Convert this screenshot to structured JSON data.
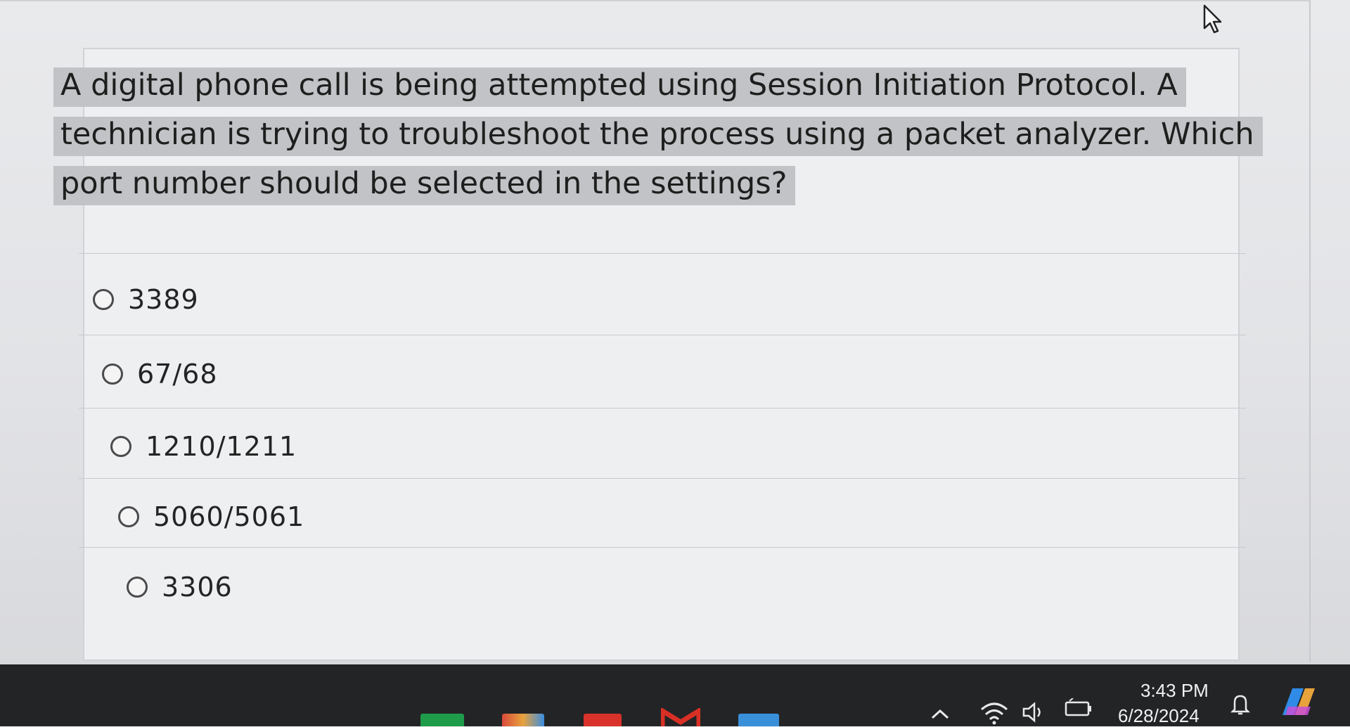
{
  "question": {
    "text": "A digital phone call is being attempted using Session Initiation Protocol. A technician is trying to troubleshoot the process using a packet analyzer. Which port number should be selected in the settings?"
  },
  "options": [
    {
      "label": "3389"
    },
    {
      "label": "67/68"
    },
    {
      "label": "1210/1211"
    },
    {
      "label": "5060/5061"
    },
    {
      "label": "3306"
    }
  ],
  "taskbar": {
    "time": "3:43 PM",
    "date": "6/28/2024",
    "tray_icons": [
      "chevron-up-icon",
      "wifi-icon",
      "speaker-icon",
      "battery-icon",
      "notification-bell-icon",
      "copilot-icon"
    ]
  },
  "colors": {
    "question_highlight": "#c2c3c6",
    "taskbar": "#232426",
    "gmail_red": "#d93025"
  }
}
